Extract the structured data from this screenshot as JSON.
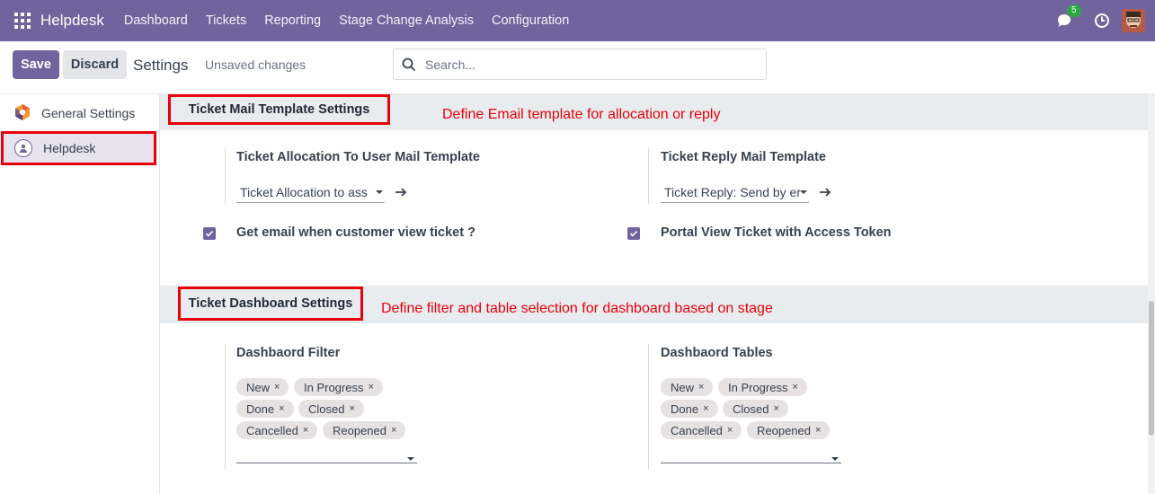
{
  "navbar": {
    "brand": "Helpdesk",
    "menu": [
      "Dashboard",
      "Tickets",
      "Reporting",
      "Stage Change Analysis",
      "Configuration"
    ],
    "chat_count": "5",
    "icons": [
      "apps-grid-icon",
      "chat-icon",
      "clock-icon",
      "avatar"
    ]
  },
  "control_panel": {
    "save_label": "Save",
    "discard_label": "Discard",
    "title": "Settings",
    "status": "Unsaved changes",
    "search_placeholder": "Search..."
  },
  "sidebar": {
    "items": [
      {
        "label": "General Settings",
        "icon": "odoo-logo-icon"
      },
      {
        "label": "Helpdesk",
        "icon": "helpdesk-icon",
        "active": true
      }
    ]
  },
  "sections": {
    "mail": {
      "title": "Ticket Mail Template Settings",
      "annotation": "Define Email template for allocation or reply",
      "allocation_label": "Ticket Allocation To User Mail Template",
      "allocation_value": "Ticket Allocation to ass",
      "reply_label": "Ticket Reply Mail Template",
      "reply_value": "Ticket Reply: Send by er",
      "email_check_label": "Get email when customer view ticket ?",
      "email_check_value": true,
      "portal_check_label": "Portal View Ticket with Access Token",
      "portal_check_value": true
    },
    "dashboard": {
      "title": "Ticket Dashboard Settings",
      "annotation": "Define filter and table selection for dashboard based on stage",
      "filter_label": "Dashbaord Filter",
      "filter_tags": [
        "New",
        "In Progress",
        "Done",
        "Closed",
        "Cancelled",
        "Reopened"
      ],
      "tables_label": "Dashbaord Tables",
      "tables_tags": [
        "New",
        "In Progress",
        "Done",
        "Closed",
        "Cancelled",
        "Reopened"
      ],
      "remove_glyph": "×"
    }
  },
  "colors": {
    "brand": "#71639e",
    "annotation": "#e8000b",
    "section_bg": "#e9ecef",
    "tag_bg": "#e6e2e1"
  }
}
